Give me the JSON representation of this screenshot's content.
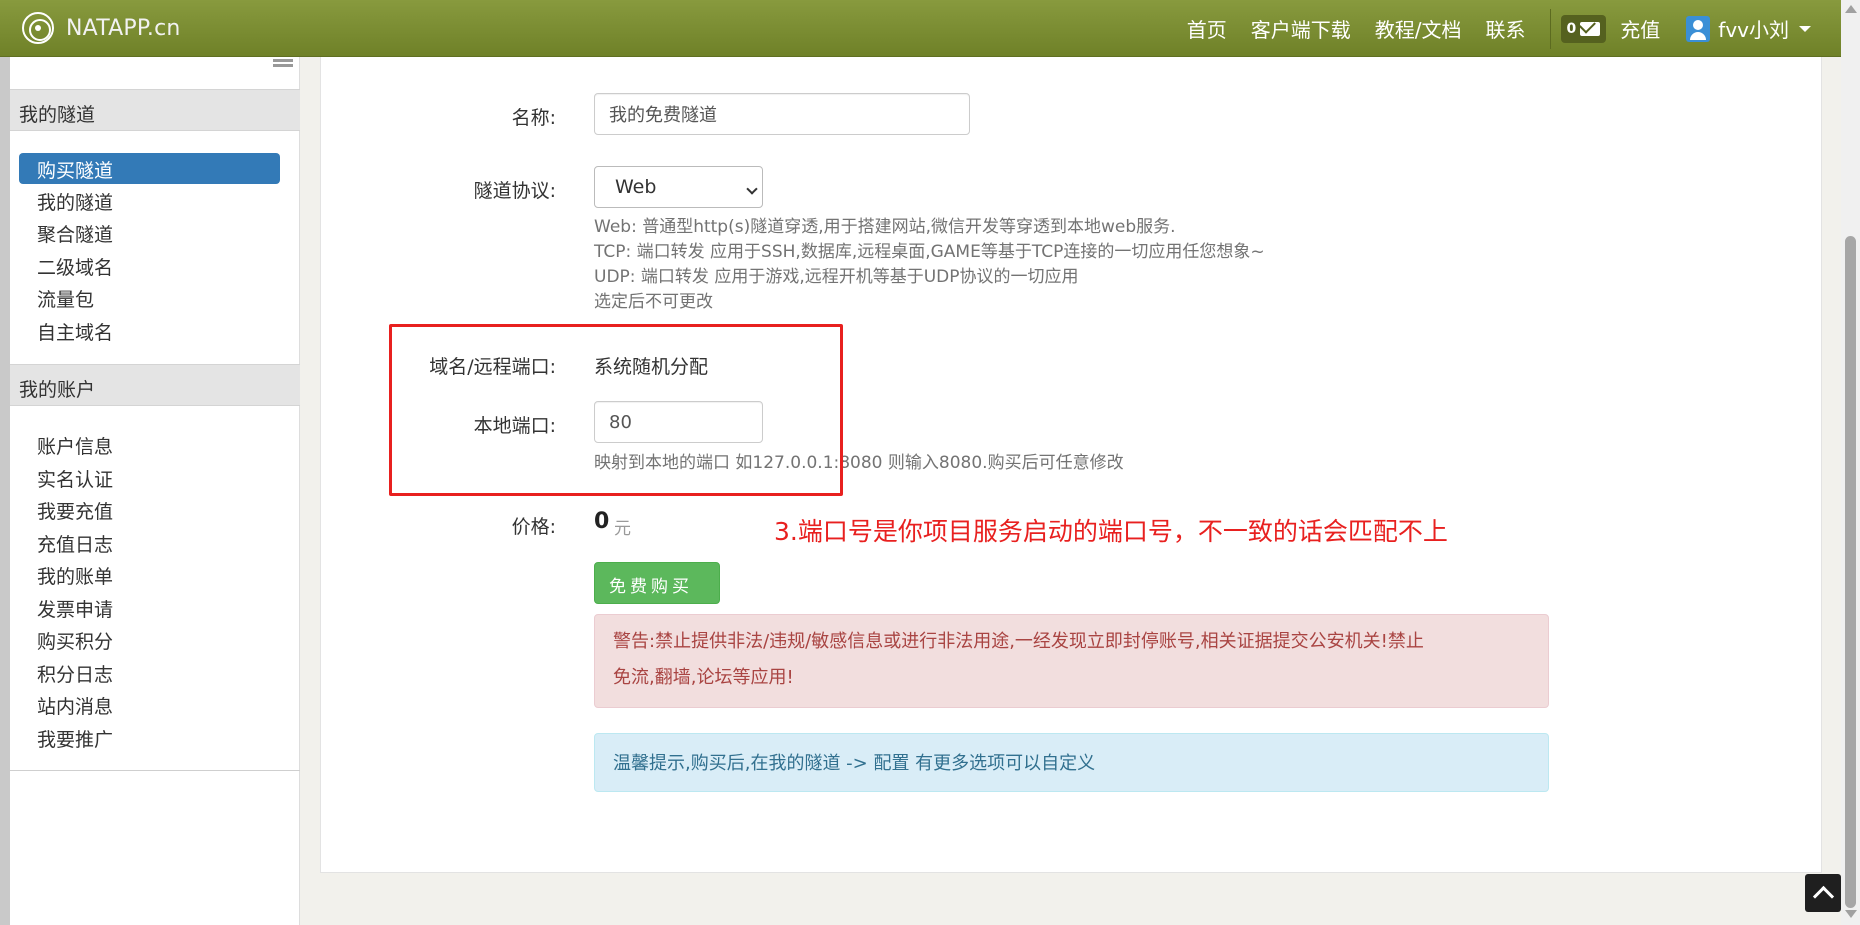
{
  "brand": {
    "name": "NATAPP.cn"
  },
  "nav": {
    "links": [
      "首页",
      "客户端下载",
      "教程/文档",
      "联系"
    ],
    "mail_count": "0",
    "recharge": "充值",
    "user": "fvv小刘"
  },
  "sidebar": {
    "tunnels_header": "我的隧道",
    "tunnel_items": [
      {
        "label": "购买隧道",
        "active": true
      },
      {
        "label": "我的隧道"
      },
      {
        "label": "聚合隧道"
      },
      {
        "label": "二级域名"
      },
      {
        "label": "流量包"
      },
      {
        "label": "自主域名"
      }
    ],
    "account_header": "我的账户",
    "account_items": [
      "账户信息",
      "实名认证",
      "我要充值",
      "充值日志",
      "我的账单",
      "发票申请",
      "购买积分",
      "积分日志",
      "站内消息",
      "我要推广"
    ]
  },
  "form": {
    "name_label": "名称:",
    "name_value": "我的免费隧道",
    "protocol_label": "隧道协议:",
    "protocol_value": "Web",
    "protocol_help": [
      "Web: 普通型http(s)隧道穿透,用于搭建网站,微信开发等穿透到本地web服务.",
      "TCP: 端口转发 应用于SSH,数据库,远程桌面,GAME等基于TCP连接的一切应用任您想象~",
      "UDP: 端口转发 应用于游戏,远程开机等基于UDP协议的一切应用",
      "选定后不可更改"
    ],
    "domain_label": "域名/远程端口:",
    "domain_value": "系统随机分配",
    "local_port_label": "本地端口:",
    "local_port_value": "80",
    "local_port_help": "映射到本地的端口 如127.0.0.1:8080 则输入8080.购买后可任意修改",
    "price_label": "价格:",
    "price_value": "0",
    "price_unit": "元",
    "buy_button": "免费购买",
    "warning_line1": "警告:禁止提供非法/违规/敏感信息或进行非法用途,一经发现立即封停账号,相关证据提交公安机关!禁止",
    "warning_line2": "免流,翻墙,论坛等应用!",
    "tip": "温馨提示,购买后,在我的隧道 -> 配置 有更多选项可以自定义"
  },
  "annotation": {
    "text": "3.端口号是你项目服务启动的端口号，不一致的话会匹配不上",
    "color": "#e8201f"
  },
  "colors": {
    "navbar": "#7a8c32",
    "active_item": "#337ab7",
    "buy_button": "#5cb85c"
  }
}
